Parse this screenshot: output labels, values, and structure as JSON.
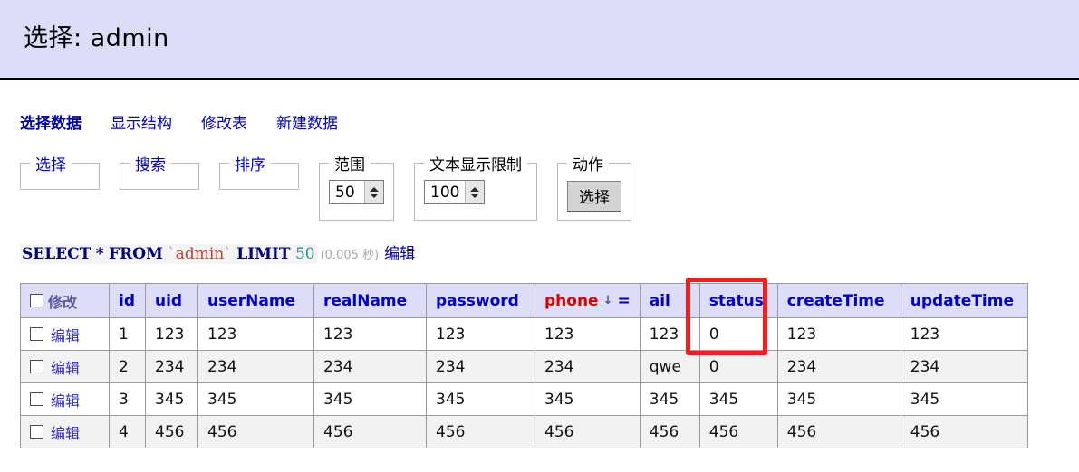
{
  "header": {
    "title": "选择: admin",
    "background": "#ddddf8"
  },
  "tabs": [
    {
      "label": "选择数据",
      "active": true
    },
    {
      "label": "显示结构",
      "active": false
    },
    {
      "label": "修改表",
      "active": false
    },
    {
      "label": "新建数据",
      "active": false
    }
  ],
  "fieldsets": {
    "select": {
      "legend": "选择"
    },
    "search": {
      "legend": "搜索"
    },
    "sort": {
      "legend": "排序"
    },
    "range": {
      "legend": "范围",
      "value": "50"
    },
    "text_limit": {
      "legend": "文本显示限制",
      "value": "100"
    },
    "action": {
      "legend": "动作",
      "button_label": "选择"
    }
  },
  "sql": {
    "keyword_select": "SELECT",
    "star": "*",
    "keyword_from": "FROM",
    "backtick": "`",
    "table_name": "admin",
    "keyword_limit": "LIMIT",
    "limit_value": "50",
    "timing": "(0.005 秒)",
    "edit_label": "编辑"
  },
  "table": {
    "header_edit_label": "修改",
    "row_edit_label": "编辑",
    "sort_arrow": "↓",
    "equals_sign": "=",
    "sorted_column": "phone",
    "columns": [
      {
        "key": "id",
        "label": "id"
      },
      {
        "key": "uid",
        "label": "uid"
      },
      {
        "key": "userName",
        "label": "userName"
      },
      {
        "key": "realName",
        "label": "realName"
      },
      {
        "key": "password",
        "label": "password"
      },
      {
        "key": "phone",
        "label": "phone"
      },
      {
        "key": "email",
        "label": "ail"
      },
      {
        "key": "status",
        "label": "status"
      },
      {
        "key": "createTime",
        "label": "createTime"
      },
      {
        "key": "updateTime",
        "label": "updateTime"
      }
    ],
    "rows": [
      {
        "id": "1",
        "uid": "123",
        "userName": "123",
        "realName": "123",
        "password": "123",
        "phone": "123",
        "email": "123",
        "status": "0",
        "createTime": "123",
        "updateTime": "123"
      },
      {
        "id": "2",
        "uid": "234",
        "userName": "234",
        "realName": "234",
        "password": "234",
        "phone": "234",
        "email": "qwe",
        "status": "0",
        "createTime": "234",
        "updateTime": "234"
      },
      {
        "id": "3",
        "uid": "345",
        "userName": "345",
        "realName": "345",
        "password": "345",
        "phone": "345",
        "email": "345",
        "status": "345",
        "createTime": "345",
        "updateTime": "345"
      },
      {
        "id": "4",
        "uid": "456",
        "userName": "456",
        "realName": "456",
        "password": "456",
        "phone": "456",
        "email": "456",
        "status": "456",
        "createTime": "456",
        "updateTime": "456"
      }
    ]
  },
  "annotation": {
    "color": "#ff1a1a",
    "target": "status"
  }
}
